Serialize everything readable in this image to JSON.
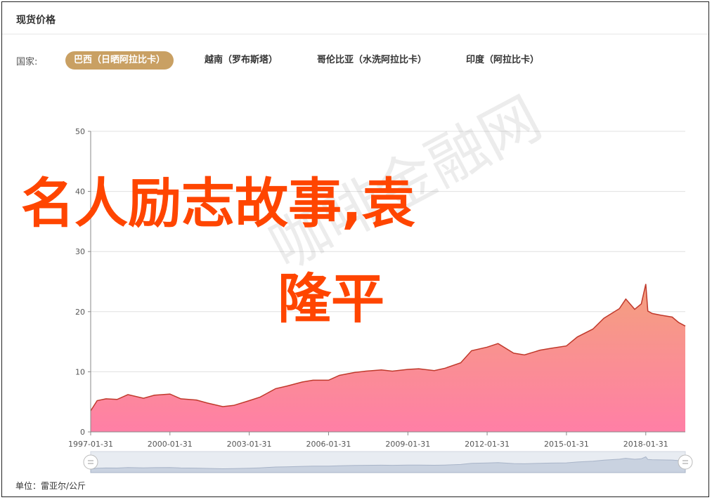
{
  "title": "现货价格",
  "country_label": "国家:",
  "countries": [
    {
      "label": "巴西（日晒阿拉比卡）",
      "active": true
    },
    {
      "label": "越南（罗布斯塔）",
      "active": false
    },
    {
      "label": "哥伦比亚（水洗阿拉比卡）",
      "active": false
    },
    {
      "label": "印度（阿拉比卡）",
      "active": false
    }
  ],
  "overlay_text_line1": "名人励志故事,袁",
  "overlay_text_line2": "隆平",
  "watermark": "咖啡金融网",
  "unit": "单位：雷亚尔/公斤",
  "colors": {
    "accent": "#c9a063",
    "line": "#c0392b",
    "fill_top": "#f4a07e",
    "fill_bottom": "#ff7fa6",
    "overlay": "#ff4500"
  },
  "chart_data": {
    "type": "area",
    "ylim": [
      0,
      50
    ],
    "yticks": [
      0,
      10,
      20,
      30,
      40,
      50
    ],
    "xlim": [
      "1997-01-31",
      "2019-07-31"
    ],
    "xticks": [
      "1997-01-31",
      "2000-01-31",
      "2003-01-31",
      "2006-01-31",
      "2009-01-31",
      "2012-01-31",
      "2015-01-31",
      "2018-01-31"
    ],
    "grid": true,
    "series": [
      {
        "x": [
          "1997-01-31",
          "1997-04-30",
          "1997-08-31",
          "1998-01-31",
          "1998-06-30",
          "1999-01-31",
          "1999-06-30",
          "2000-01-31",
          "2000-06-30",
          "2001-01-31",
          "2001-06-30",
          "2002-01-31",
          "2002-06-30",
          "2003-01-31",
          "2003-06-30",
          "2004-01-31",
          "2004-06-30",
          "2005-01-31",
          "2005-06-30",
          "2006-01-31",
          "2006-06-30",
          "2007-01-31",
          "2007-06-30",
          "2008-01-31",
          "2008-06-30",
          "2009-01-31",
          "2009-06-30",
          "2010-01-31",
          "2010-06-30",
          "2011-01-31",
          "2011-06-30",
          "2012-01-31",
          "2012-06-30",
          "2013-01-31",
          "2013-06-30",
          "2014-01-31",
          "2014-06-30",
          "2015-01-31",
          "2015-06-30",
          "2016-01-31",
          "2016-06-30",
          "2017-01-31",
          "2017-04-30",
          "2017-08-31",
          "2017-11-30",
          "2018-01-31",
          "2018-02-28",
          "2018-04-30",
          "2018-08-31",
          "2019-01-31",
          "2019-04-30",
          "2019-07-31"
        ],
        "values": [
          3.5,
          5.2,
          5.5,
          5.4,
          6.2,
          5.6,
          6.1,
          6.3,
          5.5,
          5.3,
          4.8,
          4.2,
          4.4,
          5.2,
          5.8,
          7.2,
          7.6,
          8.3,
          8.6,
          8.6,
          9.4,
          9.9,
          10.1,
          10.3,
          10.1,
          10.4,
          10.5,
          10.2,
          10.6,
          11.5,
          13.5,
          14.1,
          14.7,
          13.1,
          12.8,
          13.6,
          13.9,
          14.3,
          15.8,
          17.1,
          18.9,
          20.5,
          22.1,
          20.4,
          21.3,
          24.6,
          20.1,
          19.7,
          19.4,
          19.1,
          18.2,
          17.6
        ]
      }
    ]
  }
}
